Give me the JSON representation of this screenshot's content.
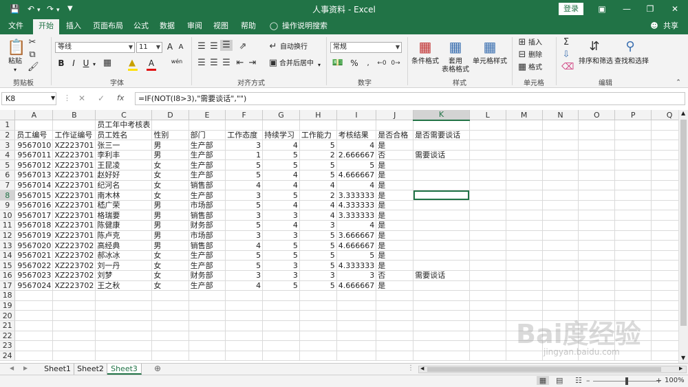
{
  "window": {
    "title": "人事资料 - Excel",
    "login_label": "登录",
    "share_label": "共享"
  },
  "menu": {
    "tabs": [
      "文件",
      "开始",
      "插入",
      "页面布局",
      "公式",
      "数据",
      "审阅",
      "视图",
      "帮助"
    ],
    "active_index": 1,
    "search_label": "操作说明搜索"
  },
  "ribbon": {
    "clipboard": {
      "paste_label": "粘贴",
      "group_label": "剪贴板"
    },
    "font": {
      "font_name": "等线",
      "font_size": "11",
      "bold": "B",
      "italic": "I",
      "underline": "U",
      "group_label": "字体",
      "grow": "A",
      "shrink": "A",
      "wen": "wén"
    },
    "alignment": {
      "wrap_label": "自动换行",
      "merge_label": "合并后居中",
      "group_label": "对齐方式"
    },
    "number": {
      "format_name": "常规",
      "percent": "%",
      "group_label": "数字"
    },
    "styles": {
      "conditional_label": "条件格式",
      "table_label_1": "套用",
      "table_label_2": "表格格式",
      "cell_style_label": "单元格样式",
      "group_label": "样式"
    },
    "cells": {
      "insert_label": "插入",
      "delete_label": "删除",
      "format_label": "格式",
      "group_label": "单元格"
    },
    "editing": {
      "sort_label": "排序和筛选",
      "find_label": "查找和选择",
      "group_label": "编辑"
    }
  },
  "formula_bar": {
    "name_box": "K8",
    "fx": "fx",
    "formula": "=IF(NOT(I8>3),\"需要谈话\",\"\")"
  },
  "grid": {
    "columns": [
      "A",
      "B",
      "C",
      "D",
      "E",
      "F",
      "G",
      "H",
      "I",
      "J",
      "K",
      "L",
      "M",
      "N",
      "O",
      "P",
      "Q"
    ],
    "selected_col": "K",
    "selected_row": 8,
    "title_text": "员工年中考核表",
    "headers": [
      "员工编号",
      "工作证编号",
      "员工姓名",
      "性别",
      "部门",
      "工作态度",
      "持续学习",
      "工作能力",
      "考核结果",
      "是否合格",
      "是否需要谈话"
    ],
    "rows": [
      [
        "9567010",
        "XZ223701",
        "张三一",
        "男",
        "生产部",
        "3",
        "4",
        "5",
        "4",
        "是",
        ""
      ],
      [
        "9567011",
        "XZ223701",
        "李利丰",
        "男",
        "生产部",
        "1",
        "5",
        "2",
        "2.666667",
        "否",
        "需要谈话"
      ],
      [
        "9567012",
        "XZ223701",
        "王昆凌",
        "女",
        "生产部",
        "5",
        "5",
        "5",
        "5",
        "是",
        ""
      ],
      [
        "9567013",
        "XZ223701",
        "赵好好",
        "女",
        "生产部",
        "5",
        "4",
        "5",
        "4.666667",
        "是",
        ""
      ],
      [
        "9567014",
        "XZ223701",
        "纪河名",
        "女",
        "销售部",
        "4",
        "4",
        "4",
        "4",
        "是",
        ""
      ],
      [
        "9567015",
        "XZ223701",
        "南木林",
        "女",
        "生产部",
        "3",
        "5",
        "2",
        "3.333333",
        "是",
        ""
      ],
      [
        "9567016",
        "XZ223701",
        "嵇广荣",
        "男",
        "市场部",
        "5",
        "4",
        "4",
        "4.333333",
        "是",
        ""
      ],
      [
        "9567017",
        "XZ223701",
        "格瑞要",
        "男",
        "销售部",
        "3",
        "3",
        "4",
        "3.333333",
        "是",
        ""
      ],
      [
        "9567018",
        "XZ223701",
        "陈健康",
        "男",
        "财务部",
        "5",
        "4",
        "3",
        "4",
        "是",
        ""
      ],
      [
        "9567019",
        "XZ223701",
        "陈卢克",
        "男",
        "市场部",
        "3",
        "3",
        "5",
        "3.666667",
        "是",
        ""
      ],
      [
        "9567020",
        "XZ223702",
        "高经典",
        "男",
        "销售部",
        "4",
        "5",
        "5",
        "4.666667",
        "是",
        ""
      ],
      [
        "9567021",
        "XZ223702",
        "郝冰冰",
        "女",
        "生产部",
        "5",
        "5",
        "5",
        "5",
        "是",
        ""
      ],
      [
        "9567022",
        "XZ223702",
        "刘一丹",
        "女",
        "生产部",
        "5",
        "3",
        "5",
        "4.333333",
        "是",
        ""
      ],
      [
        "9567023",
        "XZ223702",
        "刘梦",
        "女",
        "财务部",
        "3",
        "3",
        "3",
        "3",
        "否",
        "需要谈话"
      ],
      [
        "9567024",
        "XZ223702",
        "王之秋",
        "女",
        "生产部",
        "4",
        "5",
        "5",
        "4.666667",
        "是",
        ""
      ]
    ],
    "row_numbers": [
      "1",
      "2",
      "3",
      "4",
      "5",
      "6",
      "7",
      "8",
      "9",
      "10",
      "11",
      "12",
      "13",
      "14",
      "15",
      "16",
      "17",
      "18",
      "19",
      "20",
      "21",
      "22",
      "23",
      "24"
    ]
  },
  "sheets": {
    "tabs": [
      "Sheet1",
      "Sheet2",
      "Sheet3"
    ],
    "active_index": 2
  },
  "status": {
    "zoom": "100%"
  },
  "watermark": {
    "main": "Bai度经验",
    "sub": "jingyan.baidu.com"
  },
  "colors": {
    "accent": "#217346"
  }
}
